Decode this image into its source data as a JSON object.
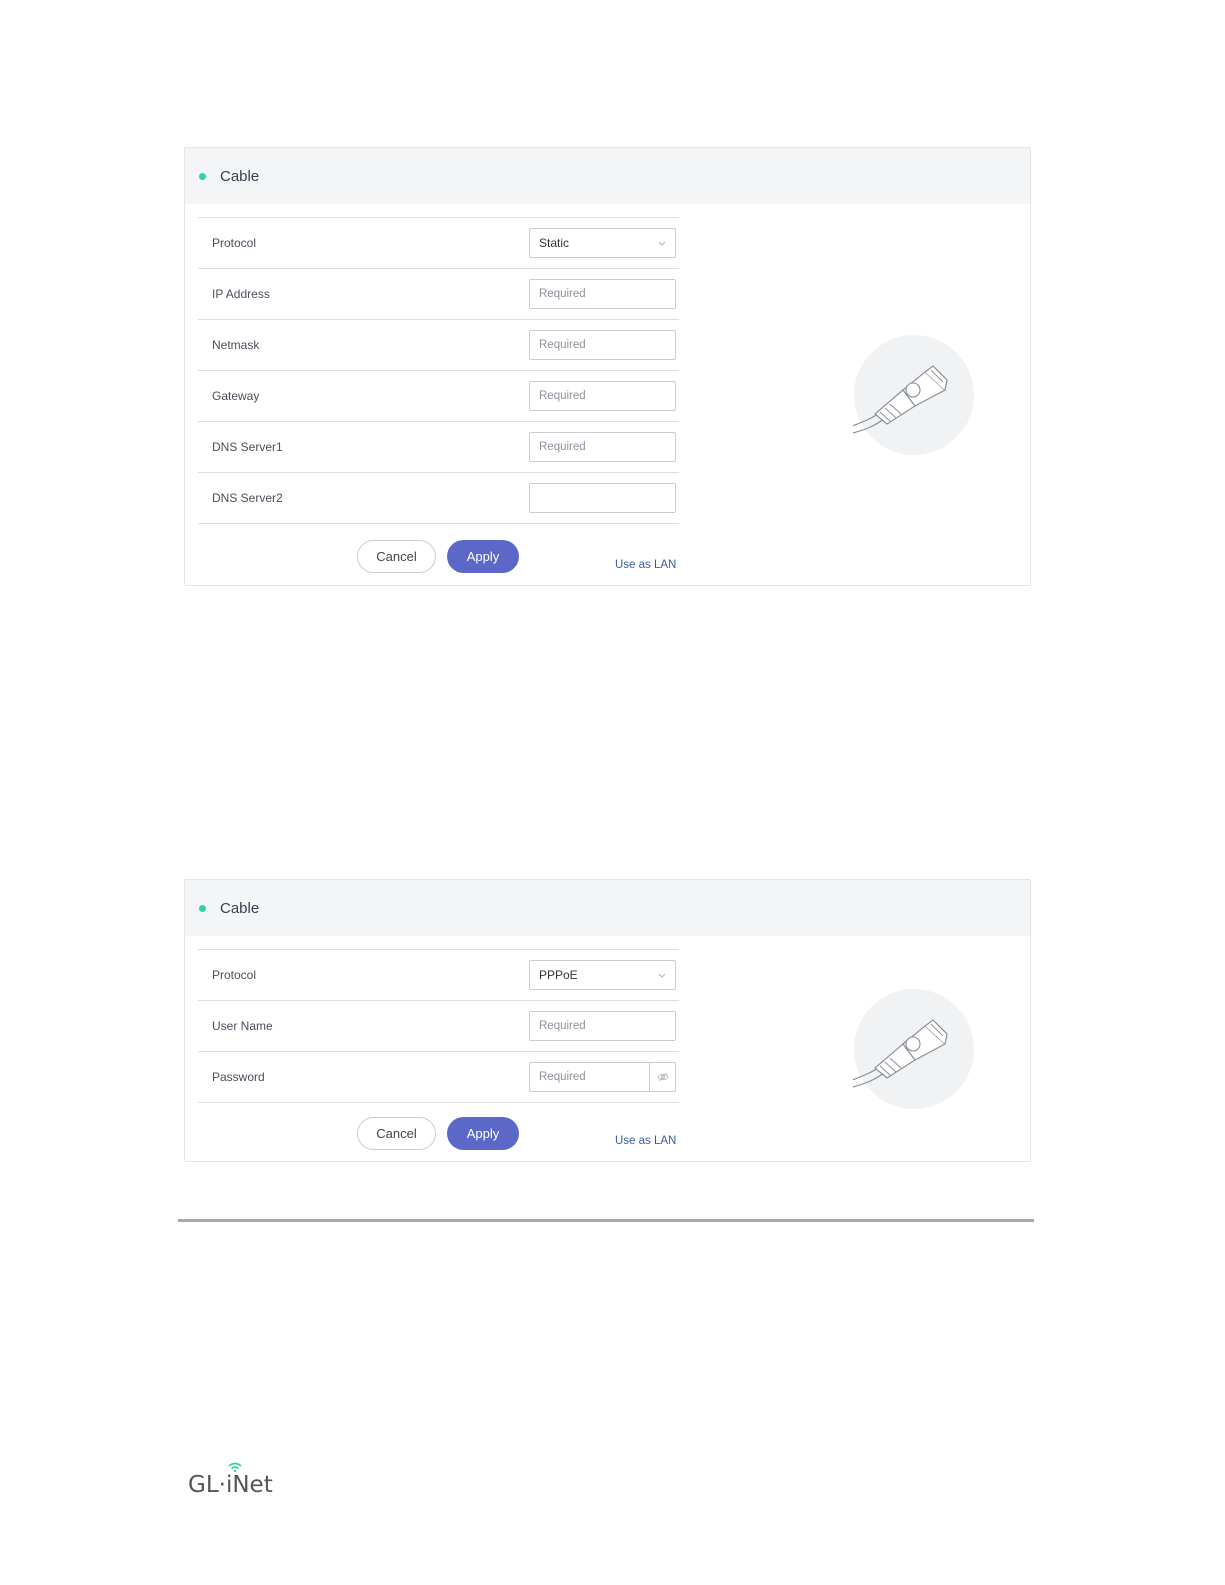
{
  "colors": {
    "accent": "#5b68c8",
    "status": "#2fd4a5",
    "link": "#3b5c9c"
  },
  "panels": [
    {
      "title": "Cable",
      "protocol": {
        "label": "Protocol",
        "value": "Static"
      },
      "fields": [
        {
          "label": "IP Address",
          "placeholder": "Required"
        },
        {
          "label": "Netmask",
          "placeholder": "Required"
        },
        {
          "label": "Gateway",
          "placeholder": "Required"
        },
        {
          "label": "DNS Server1",
          "placeholder": "Required"
        },
        {
          "label": "DNS Server2",
          "placeholder": ""
        }
      ],
      "cancel": "Cancel",
      "apply": "Apply",
      "lan_link": "Use as LAN",
      "illustration_icon": "ethernet-cable-icon"
    },
    {
      "title": "Cable",
      "protocol": {
        "label": "Protocol",
        "value": "PPPoE"
      },
      "fields": [
        {
          "label": "User Name",
          "placeholder": "Required"
        },
        {
          "label": "Password",
          "placeholder": "Required",
          "icon": "eye-icon"
        }
      ],
      "cancel": "Cancel",
      "apply": "Apply",
      "lan_link": "Use as LAN",
      "illustration_icon": "ethernet-cable-icon"
    }
  ],
  "footer": {
    "logo_text": "GL·iNet"
  }
}
